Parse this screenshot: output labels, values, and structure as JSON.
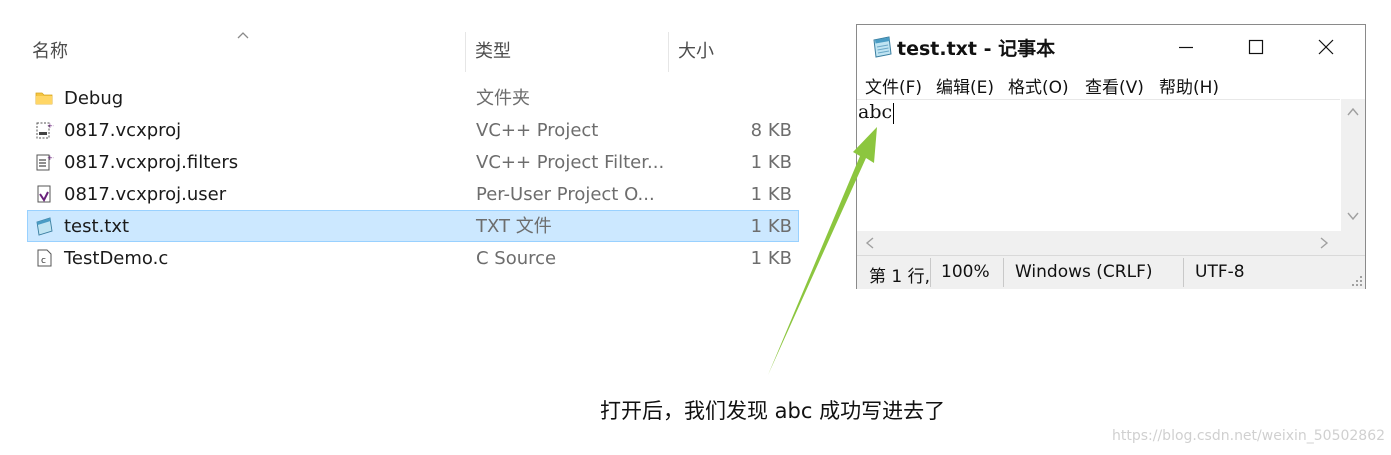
{
  "explorer": {
    "columns": {
      "name": "名称",
      "type": "类型",
      "size": "大小"
    },
    "files": [
      {
        "name": "Debug",
        "type": "文件夹",
        "size": "",
        "icon": "folder-icon",
        "selected": false
      },
      {
        "name": "0817.vcxproj",
        "type": "VC++ Project",
        "size": "8 KB",
        "icon": "vcxproj-file-icon",
        "selected": false
      },
      {
        "name": "0817.vcxproj.filters",
        "type": "VC++ Project Filter...",
        "size": "1 KB",
        "icon": "vcxproj-filters-file-icon",
        "selected": false
      },
      {
        "name": "0817.vcxproj.user",
        "type": "Per-User Project O...",
        "size": "1 KB",
        "icon": "vcxproj-user-file-icon",
        "selected": false
      },
      {
        "name": "test.txt",
        "type": "TXT 文件",
        "size": "1 KB",
        "icon": "text-file-icon",
        "selected": true
      },
      {
        "name": "TestDemo.c",
        "type": "C Source",
        "size": "1 KB",
        "icon": "c-source-file-icon",
        "selected": false
      }
    ],
    "colors": {
      "selected_bg": "#cce8ff",
      "selected_border": "#99d1ff"
    }
  },
  "notepad": {
    "title": "test.txt - 记事本",
    "menu": [
      "文件(F)",
      "编辑(E)",
      "格式(O)",
      "查看(V)",
      "帮助(H)"
    ],
    "content": "abc",
    "status": {
      "position": "第 1 行,",
      "zoom": "100%",
      "line_ending": "Windows (CRLF)",
      "encoding": "UTF-8"
    }
  },
  "annotation": {
    "caption": "打开后，我们发现 abc 成功写进去了",
    "arrow_color": "#8cc63f"
  },
  "watermark": "https://blog.csdn.net/weixin_50502862"
}
